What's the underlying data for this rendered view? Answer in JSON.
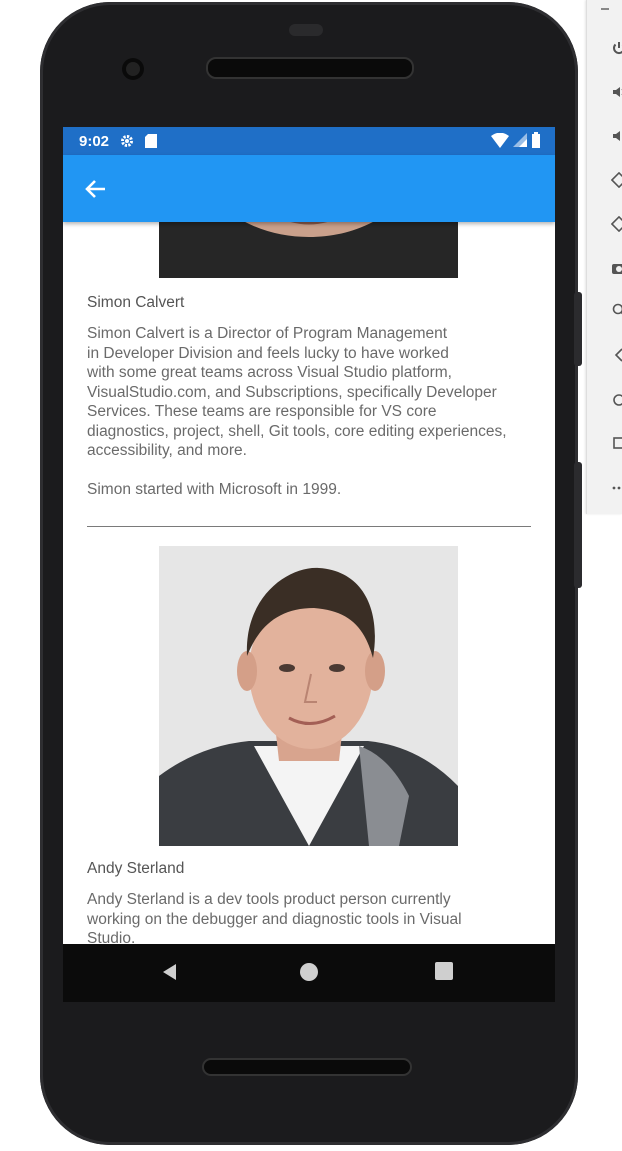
{
  "status_bar": {
    "time": "9:02",
    "icons": [
      "gear-icon",
      "sd-card-icon",
      "wifi-icon",
      "signal-icon",
      "battery-icon"
    ]
  },
  "app_bar": {
    "back_icon": "arrow-back-icon",
    "color": "#2196f3",
    "status_color": "#1f6fc7"
  },
  "people": [
    {
      "name": "Simon Calvert",
      "bio": "Simon Calvert is a Director of Program Management\nin Developer Division and feels lucky to have worked\nwith some great teams across Visual Studio platform,\nVisualStudio.com, and Subscriptions, specifically Developer\nServices. These teams are responsible for VS core\ndiagnostics, project, shell, Git tools, core editing experiences,\naccessibility, and more.\n\nSimon started with Microsoft in 1999."
    },
    {
      "name": "Andy Sterland",
      "bio": "Andy Sterland is a dev tools product person currently\nworking on the debugger and diagnostic tools in Visual\nStudio."
    }
  ],
  "nav_bar": {
    "icons": [
      "back-triangle-icon",
      "home-circle-icon",
      "recents-square-icon"
    ]
  },
  "emulator_toolbar": {
    "icons": [
      "power-icon",
      "volume-up-icon",
      "volume-down-icon",
      "rotate-left-icon",
      "rotate-right-icon",
      "camera-icon",
      "zoom-icon",
      "back-icon",
      "home-icon",
      "overview-icon",
      "more-icon"
    ]
  }
}
